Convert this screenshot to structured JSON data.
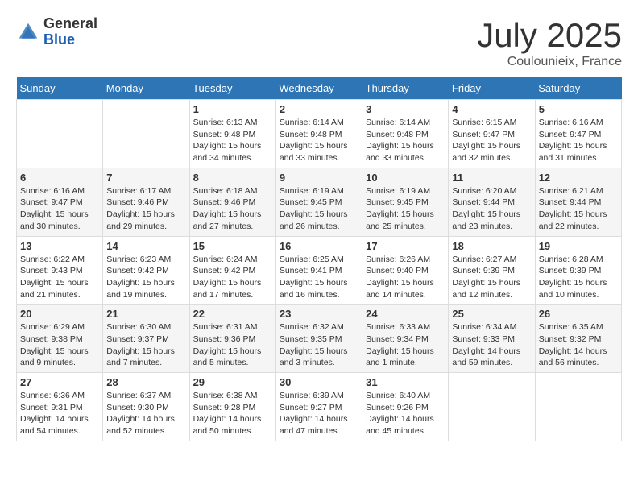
{
  "header": {
    "logo_general": "General",
    "logo_blue": "Blue",
    "month_title": "July 2025",
    "location": "Coulounieix, France"
  },
  "days_of_week": [
    "Sunday",
    "Monday",
    "Tuesday",
    "Wednesday",
    "Thursday",
    "Friday",
    "Saturday"
  ],
  "weeks": [
    [
      {
        "day": "",
        "info": ""
      },
      {
        "day": "",
        "info": ""
      },
      {
        "day": "1",
        "info": "Sunrise: 6:13 AM\nSunset: 9:48 PM\nDaylight: 15 hours and 34 minutes."
      },
      {
        "day": "2",
        "info": "Sunrise: 6:14 AM\nSunset: 9:48 PM\nDaylight: 15 hours and 33 minutes."
      },
      {
        "day": "3",
        "info": "Sunrise: 6:14 AM\nSunset: 9:48 PM\nDaylight: 15 hours and 33 minutes."
      },
      {
        "day": "4",
        "info": "Sunrise: 6:15 AM\nSunset: 9:47 PM\nDaylight: 15 hours and 32 minutes."
      },
      {
        "day": "5",
        "info": "Sunrise: 6:16 AM\nSunset: 9:47 PM\nDaylight: 15 hours and 31 minutes."
      }
    ],
    [
      {
        "day": "6",
        "info": "Sunrise: 6:16 AM\nSunset: 9:47 PM\nDaylight: 15 hours and 30 minutes."
      },
      {
        "day": "7",
        "info": "Sunrise: 6:17 AM\nSunset: 9:46 PM\nDaylight: 15 hours and 29 minutes."
      },
      {
        "day": "8",
        "info": "Sunrise: 6:18 AM\nSunset: 9:46 PM\nDaylight: 15 hours and 27 minutes."
      },
      {
        "day": "9",
        "info": "Sunrise: 6:19 AM\nSunset: 9:45 PM\nDaylight: 15 hours and 26 minutes."
      },
      {
        "day": "10",
        "info": "Sunrise: 6:19 AM\nSunset: 9:45 PM\nDaylight: 15 hours and 25 minutes."
      },
      {
        "day": "11",
        "info": "Sunrise: 6:20 AM\nSunset: 9:44 PM\nDaylight: 15 hours and 23 minutes."
      },
      {
        "day": "12",
        "info": "Sunrise: 6:21 AM\nSunset: 9:44 PM\nDaylight: 15 hours and 22 minutes."
      }
    ],
    [
      {
        "day": "13",
        "info": "Sunrise: 6:22 AM\nSunset: 9:43 PM\nDaylight: 15 hours and 21 minutes."
      },
      {
        "day": "14",
        "info": "Sunrise: 6:23 AM\nSunset: 9:42 PM\nDaylight: 15 hours and 19 minutes."
      },
      {
        "day": "15",
        "info": "Sunrise: 6:24 AM\nSunset: 9:42 PM\nDaylight: 15 hours and 17 minutes."
      },
      {
        "day": "16",
        "info": "Sunrise: 6:25 AM\nSunset: 9:41 PM\nDaylight: 15 hours and 16 minutes."
      },
      {
        "day": "17",
        "info": "Sunrise: 6:26 AM\nSunset: 9:40 PM\nDaylight: 15 hours and 14 minutes."
      },
      {
        "day": "18",
        "info": "Sunrise: 6:27 AM\nSunset: 9:39 PM\nDaylight: 15 hours and 12 minutes."
      },
      {
        "day": "19",
        "info": "Sunrise: 6:28 AM\nSunset: 9:39 PM\nDaylight: 15 hours and 10 minutes."
      }
    ],
    [
      {
        "day": "20",
        "info": "Sunrise: 6:29 AM\nSunset: 9:38 PM\nDaylight: 15 hours and 9 minutes."
      },
      {
        "day": "21",
        "info": "Sunrise: 6:30 AM\nSunset: 9:37 PM\nDaylight: 15 hours and 7 minutes."
      },
      {
        "day": "22",
        "info": "Sunrise: 6:31 AM\nSunset: 9:36 PM\nDaylight: 15 hours and 5 minutes."
      },
      {
        "day": "23",
        "info": "Sunrise: 6:32 AM\nSunset: 9:35 PM\nDaylight: 15 hours and 3 minutes."
      },
      {
        "day": "24",
        "info": "Sunrise: 6:33 AM\nSunset: 9:34 PM\nDaylight: 15 hours and 1 minute."
      },
      {
        "day": "25",
        "info": "Sunrise: 6:34 AM\nSunset: 9:33 PM\nDaylight: 14 hours and 59 minutes."
      },
      {
        "day": "26",
        "info": "Sunrise: 6:35 AM\nSunset: 9:32 PM\nDaylight: 14 hours and 56 minutes."
      }
    ],
    [
      {
        "day": "27",
        "info": "Sunrise: 6:36 AM\nSunset: 9:31 PM\nDaylight: 14 hours and 54 minutes."
      },
      {
        "day": "28",
        "info": "Sunrise: 6:37 AM\nSunset: 9:30 PM\nDaylight: 14 hours and 52 minutes."
      },
      {
        "day": "29",
        "info": "Sunrise: 6:38 AM\nSunset: 9:28 PM\nDaylight: 14 hours and 50 minutes."
      },
      {
        "day": "30",
        "info": "Sunrise: 6:39 AM\nSunset: 9:27 PM\nDaylight: 14 hours and 47 minutes."
      },
      {
        "day": "31",
        "info": "Sunrise: 6:40 AM\nSunset: 9:26 PM\nDaylight: 14 hours and 45 minutes."
      },
      {
        "day": "",
        "info": ""
      },
      {
        "day": "",
        "info": ""
      }
    ]
  ]
}
